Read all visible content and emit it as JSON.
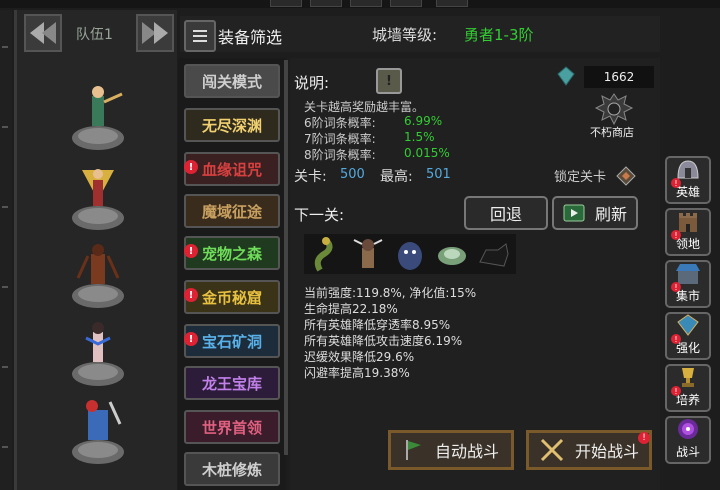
{
  "team": {
    "label": "队伍1"
  },
  "filter": {
    "label": "装备筛选"
  },
  "city_level": {
    "label": "城墙等级:",
    "value": "勇者1-3阶"
  },
  "modes": [
    {
      "label": "闯关模式",
      "alert": false,
      "color": "#cfcfcf",
      "bg": "#4a4a4a"
    },
    {
      "label": "无尽深渊",
      "alert": false,
      "color": "#f0d070",
      "bg": "#2e2a1e"
    },
    {
      "label": "血缘诅咒",
      "alert": true,
      "color": "#d84040",
      "bg": "#3a2020"
    },
    {
      "label": "魔域征途",
      "alert": false,
      "color": "#c8a060",
      "bg": "#3a2c1c"
    },
    {
      "label": "宠物之森",
      "alert": true,
      "color": "#6fdc5a",
      "bg": "#1f3a1f"
    },
    {
      "label": "金币秘窟",
      "alert": true,
      "color": "#e8c040",
      "bg": "#3a3318"
    },
    {
      "label": "宝石矿洞",
      "alert": true,
      "color": "#5ab0e8",
      "bg": "#1c2c3a"
    },
    {
      "label": "龙王宝库",
      "alert": false,
      "color": "#c080e8",
      "bg": "#2c1c3a"
    },
    {
      "label": "世界首领",
      "alert": false,
      "color": "#e06080",
      "bg": "#3a1c2a"
    },
    {
      "label": "木桩修炼",
      "alert": false,
      "color": "#cfcfcf",
      "bg": "#3a3a3a"
    }
  ],
  "info": {
    "title": "说明:",
    "desc": "关卡越高奖励越丰富。",
    "rates": [
      {
        "label": "6阶词条概率:",
        "value": "6.99%"
      },
      {
        "label": "7阶词条概率:",
        "value": "1.5%"
      },
      {
        "label": "8阶词条概率:",
        "value": "0.015%"
      }
    ],
    "stage_label": "关卡:",
    "stage_value": "500",
    "max_label": "最高:",
    "max_value": "501",
    "lock_label": "锁定关卡",
    "next_label": "下一关:",
    "back_button": "回退",
    "refresh_button": "刷新",
    "currency": "1662",
    "shop_label": "不朽商店",
    "stats": [
      "当前强度:119.8%, 净化值:15%",
      "生命提高22.18%",
      "所有英雄降低穿透率8.95%",
      "所有英雄降低攻击速度6.19%",
      "迟缓效果降低29.6%",
      "闪避率提高19.38%"
    ]
  },
  "auto_battle": "自动战斗",
  "start_battle": "开始战斗",
  "side_menu": [
    {
      "label": "英雄",
      "alert": true,
      "icon": "helmet-icon"
    },
    {
      "label": "领地",
      "alert": true,
      "icon": "castle-icon"
    },
    {
      "label": "集市",
      "alert": true,
      "icon": "market-icon"
    },
    {
      "label": "强化",
      "alert": true,
      "icon": "gem-icon"
    },
    {
      "label": "培养",
      "alert": true,
      "icon": "trophy-icon"
    },
    {
      "label": "战斗",
      "alert": false,
      "icon": "portal-icon"
    }
  ]
}
